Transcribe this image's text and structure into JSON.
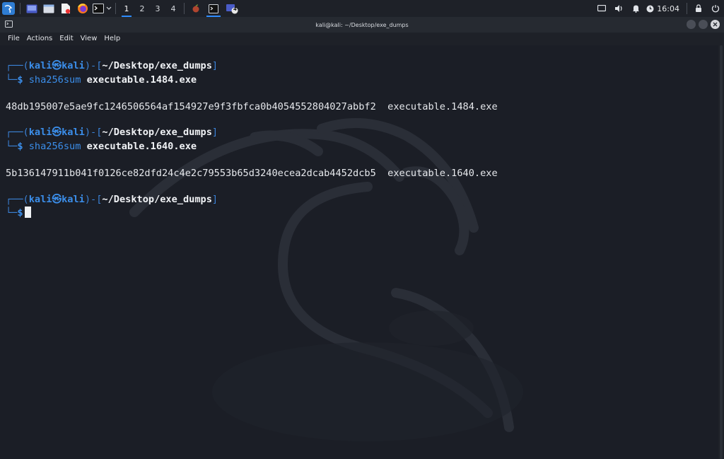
{
  "panel": {
    "apps": [
      {
        "icon": "kali-menu-icon"
      },
      {
        "icon": "show-desktop-icon"
      },
      {
        "icon": "file-manager-icon"
      },
      {
        "icon": "text-editor-icon"
      },
      {
        "icon": "firefox-icon"
      },
      {
        "icon": "terminal-icon"
      }
    ],
    "workspaces": [
      "1",
      "2",
      "3",
      "4"
    ],
    "active_workspace": "1",
    "tasks": [
      {
        "icon": "fruit-app-icon"
      },
      {
        "icon": "terminal-task-icon"
      },
      {
        "icon": "window-group-icon",
        "badge": "4"
      }
    ],
    "clock": "16:04"
  },
  "window": {
    "title": "kali@kali: ~/Desktop/exe_dumps"
  },
  "menubar": [
    "File",
    "Actions",
    "Edit",
    "View",
    "Help"
  ],
  "terminal": {
    "prompt": {
      "top_open": "┌──(",
      "user": "kali",
      "skull": "㉿",
      "host": "kali",
      "mid": ")-[",
      "path": "~/Desktop/exe_dumps",
      "close": "]",
      "bottom": "└─",
      "dollar": "$"
    },
    "entries": [
      {
        "cmd": "sha256sum",
        "arg": "executable.1484.exe",
        "output": "48db195007e5ae9fc1246506564af154927e9f3fbfca0b4054552804027abbf2  executable.1484.exe"
      },
      {
        "cmd": "sha256sum",
        "arg": "executable.1640.exe",
        "output": "5b136147911b041f0126ce82dfd24c4e2c79553b65d3240ecea2dcab4452dcb5  executable.1640.exe"
      }
    ]
  },
  "colors": {
    "accent": "#2e8cff",
    "prompt_blue": "#3b8eea",
    "terminal_bg": "#1b1e26"
  }
}
